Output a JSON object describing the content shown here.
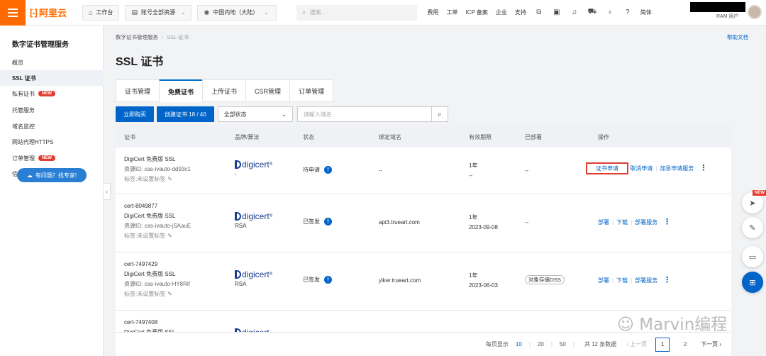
{
  "topbar": {
    "logo_text": "阿里云",
    "workbench": "工作台",
    "account_scope": "账号全部资源",
    "region": "中国内地（大陆）",
    "search_placeholder": "搜索...",
    "links": [
      "费用",
      "工单",
      "ICP 备案",
      "企业",
      "支持"
    ],
    "lang": "简体",
    "user_label": "RAM 用户"
  },
  "sidebar": {
    "title": "数字证书管理服务",
    "items": [
      {
        "label": "概览"
      },
      {
        "label": "SSL 证书"
      },
      {
        "label": "私有证书",
        "badge": "NEW"
      },
      {
        "label": "托管服务"
      },
      {
        "label": "域名监控"
      },
      {
        "label": "网站代理HTTPS"
      },
      {
        "label": "订单管理",
        "badge": "NEW"
      },
      {
        "label": "信息管理"
      }
    ],
    "help_button": "有问题？找专家!"
  },
  "breadcrumb": [
    "数字证书管理服务",
    "SSL 证书"
  ],
  "help_doc": "帮助文档",
  "page_title": "SSL 证书",
  "tabs": [
    "证书管理",
    "免费证书",
    "上传证书",
    "CSR管理",
    "订单管理"
  ],
  "toolbar": {
    "buy_now": "立即购买",
    "create_cert": "创建证书 18 / 40",
    "status_select": "全部状态",
    "domain_placeholder": "请输入域名"
  },
  "table": {
    "headers": [
      "证书",
      "品牌/算法",
      "状态",
      "绑定域名",
      "有效期限",
      "已部署",
      "操作"
    ],
    "rows": [
      {
        "name": "",
        "type": "DigiCert 免费版 SSL",
        "resource_id": "资源ID: cas-ivauto-dd93c1",
        "tag": "标签:未设置标签",
        "brand": "digicert",
        "algo": "-",
        "status": "待申请",
        "domain": "--",
        "validity": "1年",
        "expiry": "--",
        "deployed": "--",
        "actions": [
          "证书申请",
          "取消申请",
          "加急申请服务"
        ]
      },
      {
        "name": "cert-8049877",
        "type": "DigiCert 免费版 SSL",
        "resource_id": "资源ID: cas-ivauto-jSAauE",
        "tag": "标签:未设置标签",
        "brand": "digicert",
        "algo": "RSA",
        "status": "已签发",
        "domain": "api3.trueart.com",
        "validity": "1年",
        "expiry": "2023-09-08",
        "deployed": "--",
        "actions": [
          "部署",
          "下载",
          "部署服务"
        ]
      },
      {
        "name": "cert-7497429",
        "type": "DigiCert 免费版 SSL",
        "resource_id": "资源ID: cas-ivauto-HY8Rif",
        "tag": "标签:未设置标签",
        "brand": "digicert",
        "algo": "RSA",
        "status": "已签发",
        "domain": "yiker.trueart.com",
        "validity": "1年",
        "expiry": "2023-06-03",
        "deployed": "对象存储OSS",
        "actions": [
          "部署",
          "下载",
          "部署服务"
        ]
      },
      {
        "name": "cert-7497408",
        "type": "DigiCert 免费版 SSL",
        "brand": "digicert"
      }
    ]
  },
  "pagination": {
    "per_page_label": "每页显示",
    "sizes": [
      "10",
      "20",
      "50"
    ],
    "total": "共 12 条数据",
    "prev": "上一页",
    "pages": [
      "1",
      "2"
    ],
    "next": "下一页"
  },
  "watermark": "Marvin编程",
  "float_new": "NEW",
  "colors": {
    "brand_orange": "#ff6a00",
    "primary_blue": "#0064c8",
    "highlight_red": "#e03c31"
  }
}
